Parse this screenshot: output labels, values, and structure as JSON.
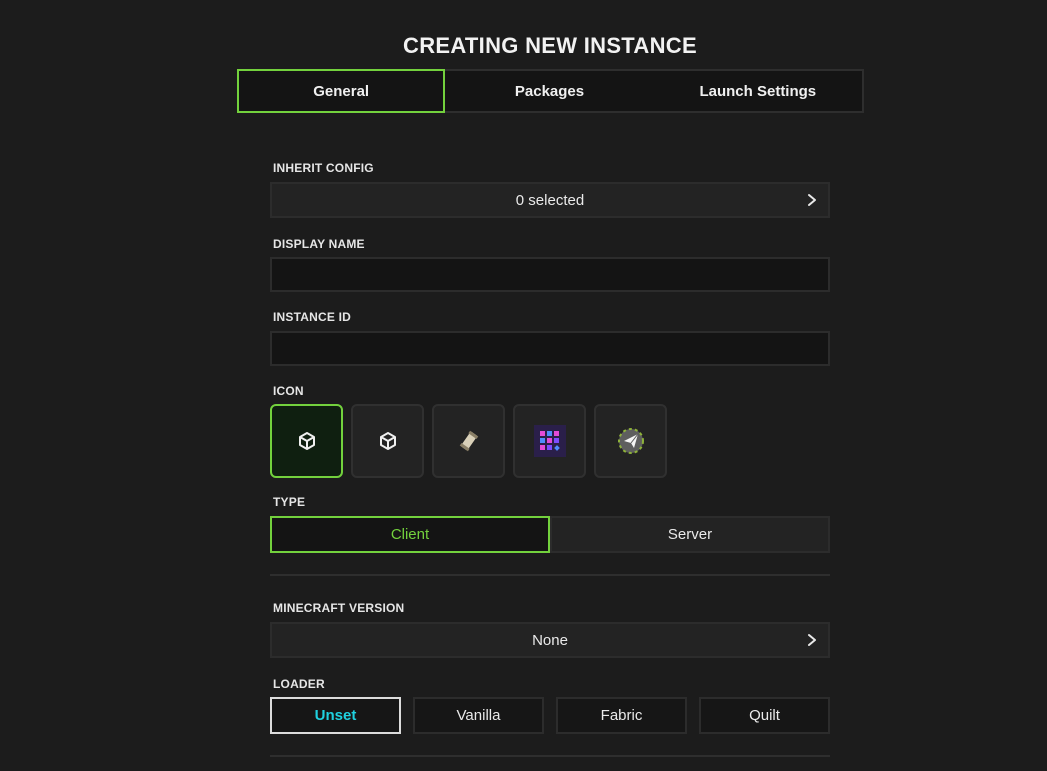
{
  "page_title": "CREATING NEW INSTANCE",
  "tabs": [
    {
      "label": "General",
      "active": true
    },
    {
      "label": "Packages",
      "active": false
    },
    {
      "label": "Launch Settings",
      "active": false
    }
  ],
  "inherit_config": {
    "label": "INHERIT CONFIG",
    "value": "0 selected"
  },
  "display_name": {
    "label": "DISPLAY NAME",
    "value": "",
    "placeholder": ""
  },
  "instance_id": {
    "label": "INSTANCE ID",
    "value": "",
    "placeholder": ""
  },
  "icon": {
    "label": "ICON",
    "options": [
      "cube-outline-icon",
      "cube-outline-icon",
      "scroll-icon",
      "purple-pixel-grid-icon",
      "paper-plane-badge-icon"
    ],
    "selected_index": 0
  },
  "type": {
    "label": "TYPE",
    "options": [
      "Client",
      "Server"
    ],
    "selected": "Client"
  },
  "minecraft_version": {
    "label": "MINECRAFT VERSION",
    "value": "None"
  },
  "loader": {
    "label": "LOADER",
    "options": [
      "Unset",
      "Vanilla",
      "Fabric",
      "Quilt"
    ],
    "selected": "Unset"
  },
  "colors": {
    "background": "#1c1c1c",
    "accent_green": "#73d13d",
    "accent_cyan": "#1fd1e0"
  }
}
